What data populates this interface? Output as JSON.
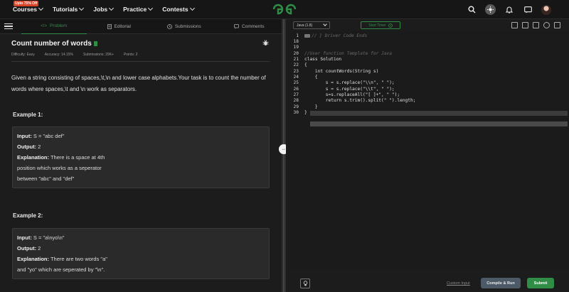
{
  "topbar": {
    "promo": "Upto 75% Off",
    "nav": [
      "Courses",
      "Tutorials",
      "Jobs",
      "Practice",
      "Contests"
    ],
    "icons": [
      "search-icon",
      "theme-icon",
      "bell-icon",
      "chat-icon",
      "avatar"
    ]
  },
  "tabs": [
    {
      "label": "Problem",
      "icon": "code-icon"
    },
    {
      "label": "Editorial",
      "icon": "doc-icon"
    },
    {
      "label": "Submissions",
      "icon": "clock-icon"
    },
    {
      "label": "Comments",
      "icon": "comment-icon"
    }
  ],
  "problem": {
    "title": "Count number of words",
    "difficulty": "Difficulty: Easy",
    "accuracy": "Accuracy: 14.15%",
    "submissions": "Submissions: 29K+",
    "points": "Points: 2",
    "description": "Given a string consisting of spaces,\\t,\\n and lower case  alphabets.Your task is to count the number of words where spaces,\\t and \\n work as separators."
  },
  "examples": [
    {
      "heading": "Example 1:",
      "input_label": "Input:",
      "input": "S = \"abc def\"",
      "output_label": "Output:",
      "output": "2",
      "explanation_label": "Explanation:",
      "explanation_lines": [
        "There is a space at 4th",
        "position which works as a seperator",
        "between \"abc\" and \"def\""
      ]
    },
    {
      "heading": "Example 2:",
      "input_label": "Input:",
      "input": "S = \"a\\nyo\\n\"",
      "output_label": "Output:",
      "output": "2",
      "explanation_label": "Explanation:",
      "explanation_lines": [
        "There are two words \"a\"",
        "and \"yo\" which are seperated by \"\\n\"."
      ]
    }
  ],
  "editor": {
    "language": "Java (1.8)",
    "timer": "Start Timer",
    "lines": [
      {
        "n": "1",
        "text": "// } Driver Code Ends"
      },
      {
        "n": "18",
        "text": ""
      },
      {
        "n": "19",
        "text": ""
      },
      {
        "n": "20",
        "text": "//User function Template for Java"
      },
      {
        "n": "21",
        "text": "class Solution"
      },
      {
        "n": "22",
        "text": "{"
      },
      {
        "n": "23",
        "text": "    int countWords(String s)"
      },
      {
        "n": "24",
        "text": "    {"
      },
      {
        "n": "25",
        "text": "        s = s.replace(\"\\\\n\", \" \");"
      },
      {
        "n": "26",
        "text": "        s = s.replace(\"\\\\t\", \" \");"
      },
      {
        "n": "27",
        "text": "        s=s.replaceAll(\"[ ]+\", \" \");"
      },
      {
        "n": "28",
        "text": "        return s.trim().split(\" \").length;"
      },
      {
        "n": "29",
        "text": "    }"
      },
      {
        "n": "30",
        "text": "}"
      }
    ]
  },
  "bottom": {
    "custom_input": "Custom Input",
    "compile_run": "Compile & Run",
    "submit": "Submit"
  }
}
